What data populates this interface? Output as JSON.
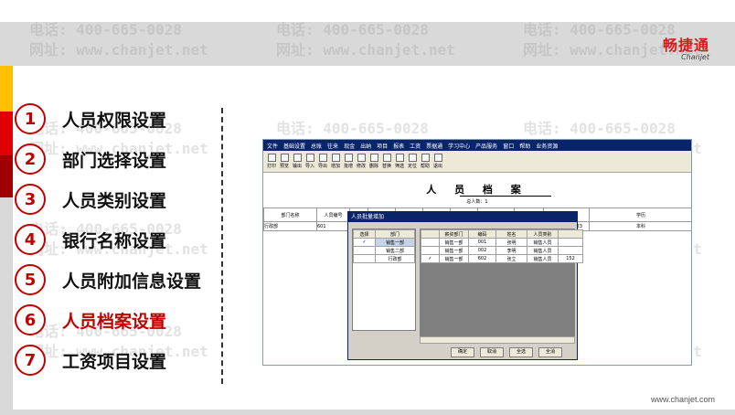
{
  "watermark": {
    "phone": "电话: 400-665-0028",
    "site": "网址: www.chanjet.net"
  },
  "logo": {
    "name": "畅捷通",
    "sub": "Chanjet"
  },
  "footer_url": "www.chanjet.com",
  "menu": {
    "items": [
      {
        "num": "1",
        "label": "人员权限设置"
      },
      {
        "num": "2",
        "label": "部门选择设置"
      },
      {
        "num": "3",
        "label": "人员类别设置"
      },
      {
        "num": "4",
        "label": "银行名称设置"
      },
      {
        "num": "5",
        "label": "人员附加信息设置"
      },
      {
        "num": "6",
        "label": "人员档案设置"
      },
      {
        "num": "7",
        "label": "工资项目设置"
      }
    ],
    "active_index": 5
  },
  "app": {
    "menubar": [
      "文件",
      "基础设置",
      "总账",
      "往来",
      "现金",
      "出纳",
      "项目",
      "报表",
      "工资",
      "票据通",
      "学习中心",
      "产品服务",
      "窗口",
      "帮助",
      "业务资源"
    ],
    "toolbar": [
      "打印",
      "预览",
      "输出",
      "导入",
      "导出",
      "增加",
      "批增",
      "修改",
      "删除",
      "替换",
      "筛选",
      "定位",
      "帮助",
      "退出"
    ],
    "title": "人 员 档 案",
    "total": "总人数：1",
    "grid": {
      "headers": [
        "部门名称",
        "人员编号",
        "",
        "",
        "",
        "",
        "",
        "",
        "进入日期",
        "手机号",
        "学历"
      ],
      "row": [
        "行政部",
        "601",
        "",
        "",
        "",
        "",
        "",
        "",
        "",
        "13523478923",
        "本科"
      ]
    },
    "dialog": {
      "title": "人员批量增加",
      "left_headers": [
        "选择",
        "部门"
      ],
      "left_rows": [
        {
          "check": "✓",
          "dept": "销售一部"
        },
        {
          "check": "",
          "dept": "销售二部"
        },
        {
          "check": "",
          "dept": "行政部"
        }
      ],
      "right_headers": [
        "",
        "薪资部门",
        "编码",
        "姓名",
        "人员类别"
      ],
      "right_rows": [
        {
          "check": "",
          "dept": "销售一部",
          "code": "001",
          "name": "张明",
          "type": "销售人员"
        },
        {
          "check": "",
          "dept": "销售一部",
          "code": "002",
          "name": "李明",
          "type": "销售人员"
        },
        {
          "check": "✓",
          "dept": "销售一部",
          "code": "602",
          "name": "张立",
          "type": "销售人员",
          "extra": "152"
        }
      ],
      "buttons": [
        "确定",
        "取消",
        "全选",
        "全消"
      ]
    }
  }
}
